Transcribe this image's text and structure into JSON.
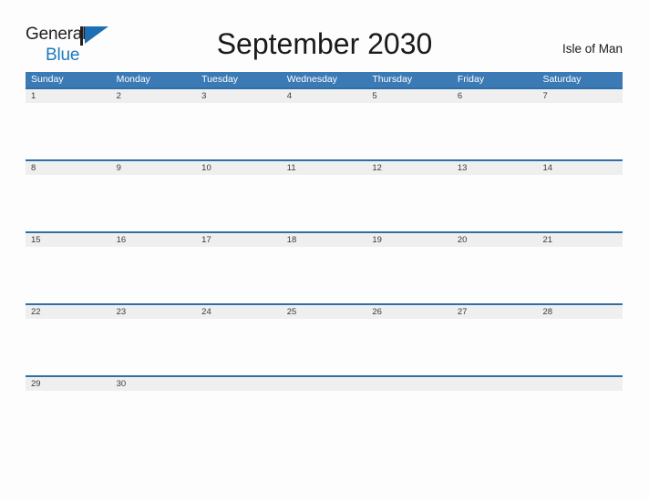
{
  "brand": {
    "name_part1": "General",
    "name_part2": "Blue",
    "flag_icon": "blue-flag-triangle-icon",
    "accent_color": "#1c7ac0"
  },
  "header": {
    "title": "September 2030",
    "location": "Isle of Man"
  },
  "calendar": {
    "header_color": "#3b7ab5",
    "row_border_color": "#2f6fa8",
    "date_band_color": "#efefef",
    "weekdays": [
      "Sunday",
      "Monday",
      "Tuesday",
      "Wednesday",
      "Thursday",
      "Friday",
      "Saturday"
    ],
    "weeks": [
      {
        "dates": [
          "1",
          "2",
          "3",
          "4",
          "5",
          "6",
          "7"
        ]
      },
      {
        "dates": [
          "8",
          "9",
          "10",
          "11",
          "12",
          "13",
          "14"
        ]
      },
      {
        "dates": [
          "15",
          "16",
          "17",
          "18",
          "19",
          "20",
          "21"
        ]
      },
      {
        "dates": [
          "22",
          "23",
          "24",
          "25",
          "26",
          "27",
          "28"
        ]
      },
      {
        "dates": [
          "29",
          "30",
          "",
          "",
          "",
          "",
          ""
        ]
      }
    ]
  }
}
